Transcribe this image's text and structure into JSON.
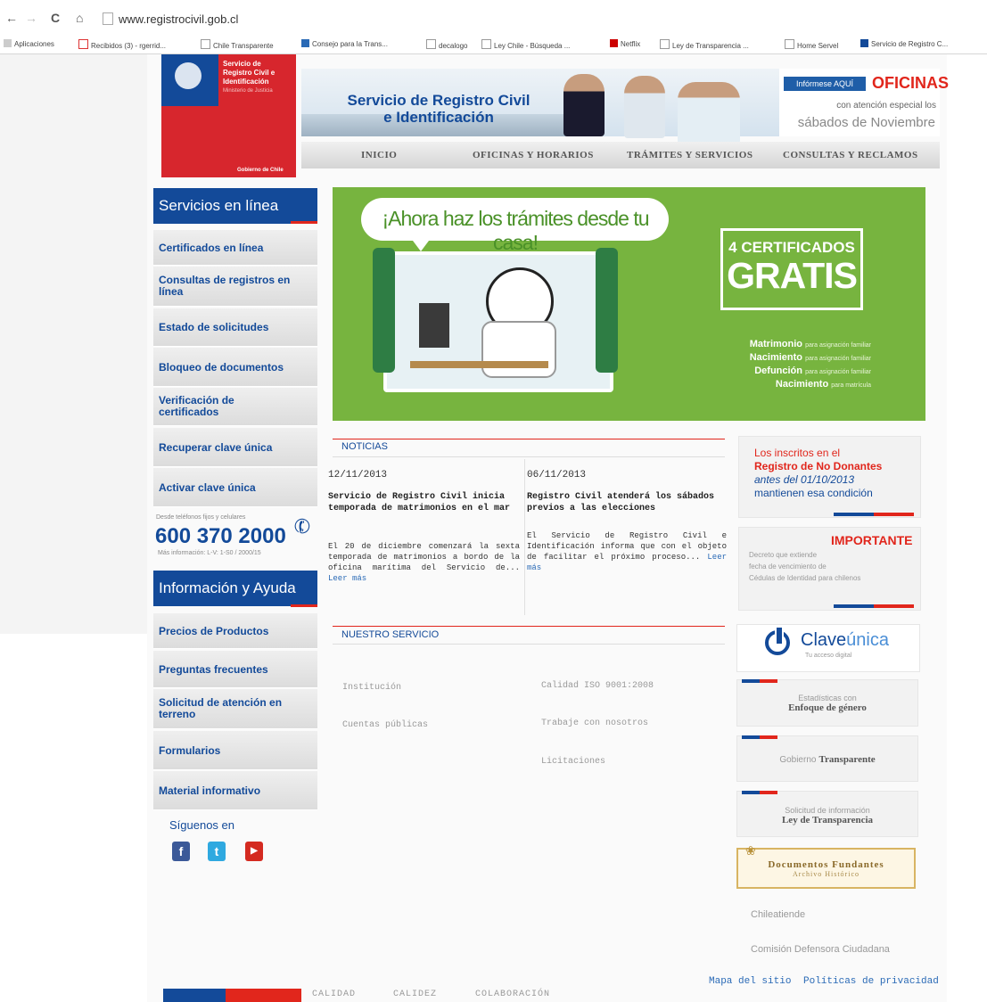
{
  "browser": {
    "url": "www.registrocivil.gob.cl",
    "bookmarks": [
      "Aplicaciones",
      "Recibidos (3) - rgerrid...",
      "Chile Transparente",
      "Consejo para la Trans...",
      "decalogo",
      "Ley Chile - Búsqueda ...",
      "Netflix",
      "Ley de Transparencia ...",
      "Home Servel",
      "Servicio de Registro C..."
    ]
  },
  "header": {
    "logo_text": [
      "Servicio de",
      "Registro Civil e",
      "Identificación"
    ],
    "logo_ministry": "Ministerio de Justicia",
    "logo_government": "Gobierno de Chile",
    "banner_title_1": "Servicio de Registro Civil",
    "banner_title_2": "e Identificación",
    "informese": "Infórmese AQUÍ",
    "oficinas": "OFICINAS",
    "oficinas_sub": "con atención especial los",
    "oficinas_sub2": "sábados de Noviembre"
  },
  "topnav": [
    "INICIO",
    "OFICINAS Y HORARIOS",
    "TRÁMITES Y SERVICIOS",
    "CONSULTAS Y RECLAMOS"
  ],
  "sidebar": {
    "servicios_title": "Servicios en línea",
    "servicios": [
      "Certificados en línea",
      "Consultas de registros en línea",
      "Estado de solicitudes",
      "Bloqueo de documentos",
      "Verificación de certificados",
      "Recuperar clave única",
      "Activar clave única"
    ],
    "phone_small": "Desde teléfonos fijos y celulares",
    "phone": "600 370 2000",
    "phone_more": "Más información: L-V: 1-S0 / 2000/15",
    "ayuda_title": "Información y Ayuda",
    "ayuda": [
      "Precios de Productos",
      "Preguntas frecuentes",
      "Solicitud de atención en terreno",
      "Formularios",
      "Material informativo"
    ],
    "siguenos": "Síguenos en"
  },
  "promo": {
    "bubble": "¡Ahora haz los trámites desde tu casa!",
    "cert_small": "4 CERTIFICADOS",
    "cert_big": "GRATIS",
    "items": [
      {
        "name": "Matrimonio",
        "note": "para asignación familiar"
      },
      {
        "name": "Nacimiento",
        "note": "para asignación familiar"
      },
      {
        "name": "Defunción",
        "note": "para asignación familiar"
      },
      {
        "name": "Nacimiento",
        "note": "para matrícula"
      }
    ]
  },
  "noticias": {
    "title": "NOTICIAS",
    "items": [
      {
        "date": "12/11/2013",
        "title": "Servicio de Registro Civil inicia temporada de matrimonios en el mar",
        "body": "El 20 de diciembre comenzará la sexta temporada de matrimonios a bordo de la oficina marítima del Servicio de...",
        "more": "Leer más"
      },
      {
        "date": "06/11/2013",
        "title": "Registro Civil atenderá los sábados previos a las elecciones",
        "body": "El Servicio de Registro Civil e Identificación informa que con el objeto de facilitar el próximo proceso...",
        "more": "Leer más"
      }
    ]
  },
  "servicio": {
    "title": "NUESTRO SERVICIO",
    "col1": [
      "Institución",
      "Cuentas públicas"
    ],
    "col2": [
      "Calidad ISO 9001:2008",
      "Trabaje con nosotros",
      "Licitaciones"
    ]
  },
  "right": {
    "donantes_1": "Los inscritos en el",
    "donantes_2": "Registro de No Donantes",
    "donantes_3": "antes del 01/10/2013",
    "donantes_4": "mantienen esa condición",
    "importante": "IMPORTANTE",
    "importante_lines": [
      "Decreto que extiende",
      "fecha de vencimiento de",
      "Cédulas de Identidad para chilenos"
    ],
    "clave_1": "Clave",
    "clave_2": "única",
    "clave_sub": "Tu acceso digital",
    "estadisticas_1": "Estadísticas con",
    "estadisticas_2": "Enfoque de género",
    "gobierno_1": "Gobierno",
    "gobierno_2": "Transparente",
    "solicitud_1": "Solicitud de información",
    "solicitud_2": "Ley de Transparencia",
    "documentos_1": "Documentos Fundantes",
    "documentos_2": "Archivo Histórico",
    "chileatiende": "Chileatiende",
    "comision": "Comisión Defensora Ciudadana"
  },
  "footer": {
    "words": [
      "CALIDAD",
      "CALIDEZ",
      "COLABORACIÓN"
    ],
    "mapa": "Mapa del sitio",
    "privacidad": "Políticas de privacidad"
  },
  "colors": {
    "blue": "#134a99",
    "red": "#e1261c",
    "green": "#77b43f"
  }
}
